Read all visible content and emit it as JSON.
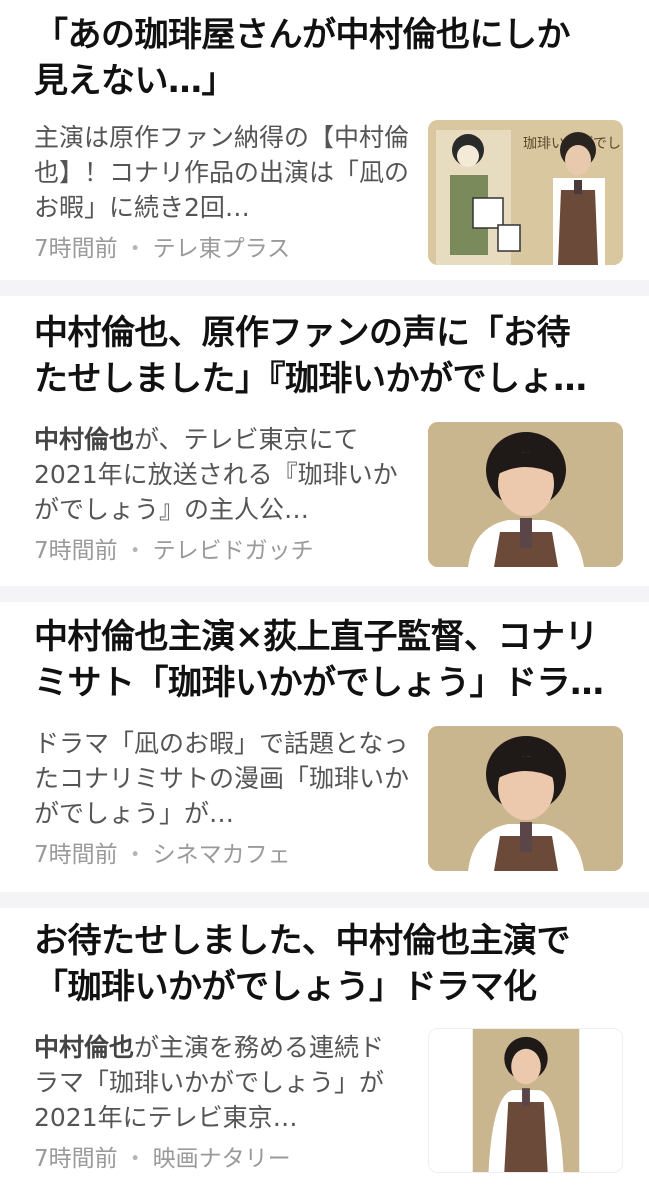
{
  "articles": [
    {
      "title_line2": "見えない…」",
      "body": "主演は原作ファン納得の【中村倫也】！コナリ作品の出演は「凪のお暇」に続き2回…",
      "time": "7時間前",
      "source": "テレ東プラス",
      "thumb_text": "珈琲いかがでしょう"
    },
    {
      "title_line1": "中村倫也、原作ファンの声に「お待",
      "title_line2": "たせしました」『珈琲いかがでしょ…",
      "body_highlight": "中村倫也",
      "body": "が、テレビ東京にて2021年に放送される『珈琲いかがでしょう』の主人公…",
      "time": "7時間前",
      "source": "テレビドガッチ"
    },
    {
      "title_line1": "中村倫也主演×荻上直子監督、コナリ",
      "title_line2": "ミサト「珈琲いかがでしょう」ドラ…",
      "body": "ドラマ「凪のお暇」で話題となったコナリミサトの漫画「珈琲いかがでしょう」が…",
      "time": "7時間前",
      "source": "シネマカフェ"
    },
    {
      "title_line1": "お待たせしました、中村倫也主演で",
      "title_line2": "「珈琲いかがでしょう」ドラマ化",
      "body_highlight": "中村倫也",
      "body": "が主演を務める連続ドラマ「珈琲いかがでしょう」が2021年にテレビ東京…",
      "time": "7時間前",
      "source": "映画ナタリー"
    }
  ],
  "top_title": "「あの珈琲屋さんが中村倫也にしか",
  "separator": "・",
  "colors": {
    "background": "#f4f4f6",
    "card": "#ffffff",
    "title": "#111111",
    "body": "#555555",
    "meta": "#9a9a9a",
    "thumb_bg": "#c9b58e"
  }
}
